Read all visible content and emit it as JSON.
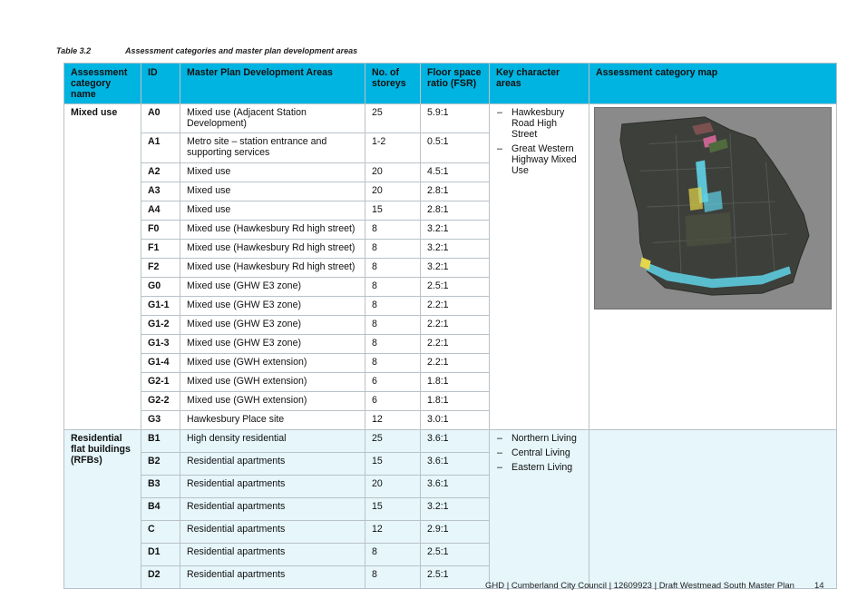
{
  "caption": {
    "number": "Table 3.2",
    "title": "Assessment categories and master plan development areas"
  },
  "table": {
    "headers": [
      "Assessment category name",
      "ID",
      "Master Plan Development Areas",
      "No. of storeys",
      "Floor space ratio (FSR)",
      "Key character areas",
      "Assessment category map"
    ],
    "mixed": {
      "category": "Mixed use",
      "key_areas": [
        "Hawkesbury Road High Street",
        "Great Western Highway Mixed Use"
      ],
      "rows": [
        {
          "id": "A0",
          "area": "Mixed use (Adjacent Station Development)",
          "storeys": "25",
          "fsr": "5.9:1"
        },
        {
          "id": "A1",
          "area": "Metro site – station entrance and supporting services",
          "storeys": "1-2",
          "fsr": "0.5:1"
        },
        {
          "id": "A2",
          "area": "Mixed use",
          "storeys": "20",
          "fsr": "4.5:1"
        },
        {
          "id": "A3",
          "area": "Mixed use",
          "storeys": "20",
          "fsr": "2.8:1"
        },
        {
          "id": "A4",
          "area": "Mixed use",
          "storeys": "15",
          "fsr": "2.8:1"
        },
        {
          "id": "F0",
          "area": "Mixed use (Hawkesbury Rd high street)",
          "storeys": "8",
          "fsr": "3.2:1"
        },
        {
          "id": "F1",
          "area": "Mixed use (Hawkesbury Rd high street)",
          "storeys": "8",
          "fsr": "3.2:1"
        },
        {
          "id": "F2",
          "area": "Mixed use (Hawkesbury Rd high street)",
          "storeys": "8",
          "fsr": "3.2:1"
        },
        {
          "id": "G0",
          "area": "Mixed use (GHW E3 zone)",
          "storeys": "8",
          "fsr": "2.5:1"
        },
        {
          "id": "G1-1",
          "area": "Mixed use (GHW E3 zone)",
          "storeys": "8",
          "fsr": "2.2:1"
        },
        {
          "id": "G1-2",
          "area": "Mixed use (GHW E3 zone)",
          "storeys": "8",
          "fsr": "2.2:1"
        },
        {
          "id": "G1-3",
          "area": "Mixed use (GHW E3 zone)",
          "storeys": "8",
          "fsr": "2.2:1"
        },
        {
          "id": "G1-4",
          "area": "Mixed use (GWH extension)",
          "storeys": "8",
          "fsr": "2.2:1"
        },
        {
          "id": "G2-1",
          "area": "Mixed use (GWH extension)",
          "storeys": "6",
          "fsr": "1.8:1"
        },
        {
          "id": "G2-2",
          "area": "Mixed use (GWH extension)",
          "storeys": "6",
          "fsr": "1.8:1"
        },
        {
          "id": "G3",
          "area": "Hawkesbury Place site",
          "storeys": "12",
          "fsr": "3.0:1"
        }
      ]
    },
    "rfb": {
      "category": "Residential flat buildings (RFBs)",
      "key_areas": [
        "Northern Living",
        "Central Living",
        "Eastern Living"
      ],
      "rows": [
        {
          "id": "B1",
          "area": "High density residential",
          "storeys": "25",
          "fsr": "3.6:1"
        },
        {
          "id": "B2",
          "area": "Residential apartments",
          "storeys": "15",
          "fsr": "3.6:1"
        },
        {
          "id": "B3",
          "area": "Residential apartments",
          "storeys": "20",
          "fsr": "3.6:1"
        },
        {
          "id": "B4",
          "area": "Residential apartments",
          "storeys": "15",
          "fsr": "3.2:1"
        },
        {
          "id": "C",
          "area": "Residential apartments",
          "storeys": "12",
          "fsr": "2.9:1"
        },
        {
          "id": "D1",
          "area": "Residential apartments",
          "storeys": "8",
          "fsr": "2.5:1"
        },
        {
          "id": "D2",
          "area": "Residential apartments",
          "storeys": "8",
          "fsr": "2.5:1"
        }
      ]
    }
  },
  "map_colors": {
    "background": "#8a8a8a",
    "site": "#3d3f3b",
    "highlight_cyan": "#5fd3e8",
    "highlight_pink": "#e06aa0",
    "highlight_yellow": "#e3d64a"
  },
  "footer": {
    "text": "GHD | Cumberland City Council | 12609923 | Draft Westmead South Master Plan",
    "page": "14"
  }
}
